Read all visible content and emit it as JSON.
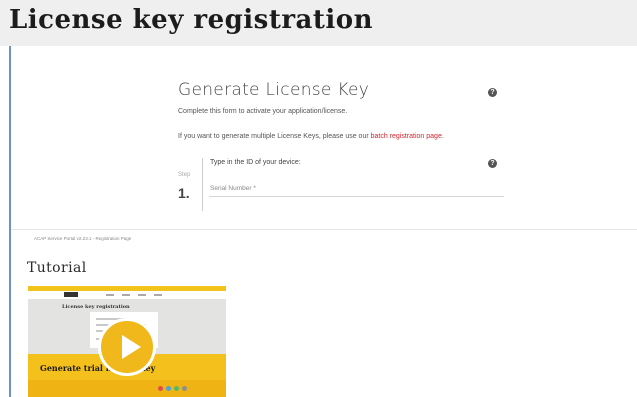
{
  "page": {
    "banner_title": "License key registration"
  },
  "form": {
    "title": "Generate License Key",
    "description": "Complete this form to activate your application/license.",
    "multi_text": "If you want to generate multiple License Keys, please use our",
    "batch_link": "batch registration page",
    "multi_suffix": ".",
    "step_label": "Step",
    "step_number": "1.",
    "device_label": "Type in the ID of your device:",
    "serial_placeholder": "Serial Number *",
    "serial_value": ""
  },
  "footer": {
    "note": "ACAP Service Portal v2.23.1 - Registration Page"
  },
  "tutorial": {
    "heading": "Tutorial",
    "thumb_title": "License key registration",
    "thumb_caption": "Generate trial license key"
  },
  "colors": {
    "accent_link": "#d0262e",
    "thumb_yellow": "#f4c01c",
    "left_rule": "#6f8fd0"
  }
}
